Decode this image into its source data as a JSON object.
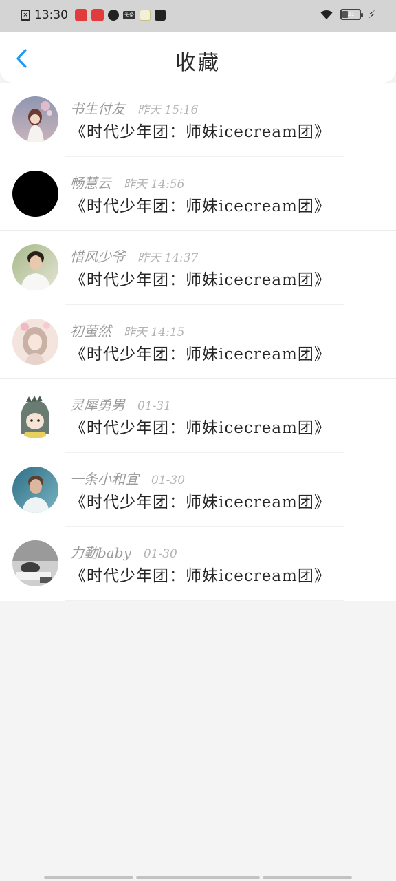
{
  "status_bar": {
    "time": "13:30",
    "left_icons": [
      "sim-card-icon",
      "app-icon-red-1",
      "app-icon-red-2",
      "app-icon-circle",
      "app-icon-toutiao",
      "app-icon-yellow",
      "app-icon-bag"
    ],
    "toutiao_label": "头条",
    "right_icons": [
      "wifi-icon",
      "battery-icon",
      "charging-icon"
    ],
    "battery_level_percent": 31,
    "battery_label": "31"
  },
  "header": {
    "back_icon": "chevron-left-icon",
    "title": "收藏",
    "accent_color": "#1e9bf0"
  },
  "favorites": [
    {
      "name": "书生付友",
      "time": "昨天 15:16",
      "title": "《时代少年团：师妹icecream团》",
      "avatar": "avatar-pink-fireworks"
    },
    {
      "name": "畅慧云",
      "time": "昨天 14:56",
      "title": "《时代少年团：师妹icecream团》",
      "avatar": "avatar-black"
    },
    {
      "name": "惜风少爷",
      "time": "昨天 14:37",
      "title": "《时代少年团：师妹icecream团》",
      "avatar": "avatar-boy-white-shirt"
    },
    {
      "name": "初萤然",
      "time": "昨天 14:15",
      "title": "《时代少年团：师妹icecream团》",
      "avatar": "avatar-anime-girl"
    },
    {
      "name": "灵犀勇男",
      "time": "01-31",
      "title": "《时代少年团：师妹icecream团》",
      "avatar": "avatar-dino-hood"
    },
    {
      "name": "一条小和宜",
      "time": "01-30",
      "title": "《时代少年团：师妹icecream团》",
      "avatar": "avatar-boy-blue"
    },
    {
      "name": "力勤baby",
      "time": "01-30",
      "title": "《时代少年团：师妹icecream团》",
      "avatar": "avatar-grayscale"
    }
  ]
}
